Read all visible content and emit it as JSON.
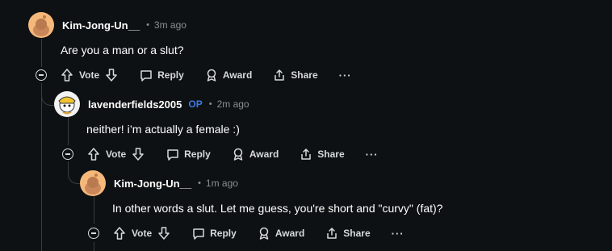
{
  "comments": [
    {
      "username": "Kim-Jong-Un__",
      "time": "3m ago",
      "body": "Are you a man or a slut?",
      "op_badge": ""
    },
    {
      "username": "lavenderfields2005",
      "time": "2m ago",
      "body": "neither! i’m actually a female :)",
      "op_badge": "OP"
    },
    {
      "username": "Kim-Jong-Un__",
      "time": "1m ago",
      "body": "In other words a slut. Let me guess, you're short and \"curvy\" (fat)?",
      "op_badge": ""
    }
  ],
  "actions": {
    "vote": "Vote",
    "reply": "Reply",
    "award": "Award",
    "share": "Share",
    "more": "···"
  },
  "separator": "•",
  "colors": {
    "background": "#0e1113",
    "op": "#3d7be5",
    "avatar_orange": "#f4b97a"
  }
}
